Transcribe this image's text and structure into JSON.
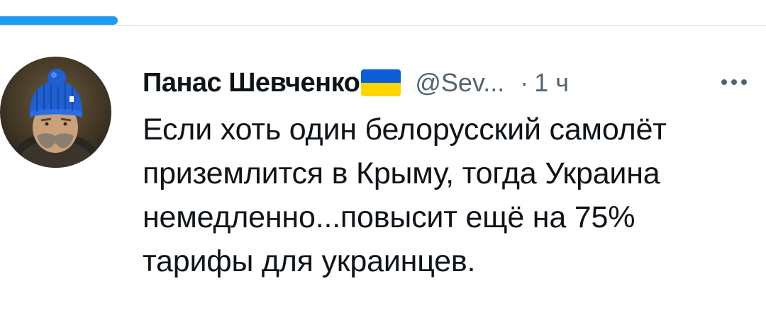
{
  "tweet": {
    "author_name": "Панас Шевченко",
    "author_flag": "ukraine-flag-icon",
    "handle": "@Sev...",
    "separator": "·",
    "time": "1 ч",
    "more_icon": "more-options-icon",
    "text_lines": [
      "Если хоть один белорусский самолёт",
      "приземлится в Крыму, тогда Украина",
      "немедленно...повысит ещё на 75%",
      "тарифы для украинцев."
    ]
  },
  "colors": {
    "accent": "#1d9bf0",
    "text": "#0f1419",
    "secondary_text": "#536471",
    "divider": "#e6ecf0",
    "flag_blue": "#0a5fd6",
    "flag_yellow": "#ffd500"
  }
}
